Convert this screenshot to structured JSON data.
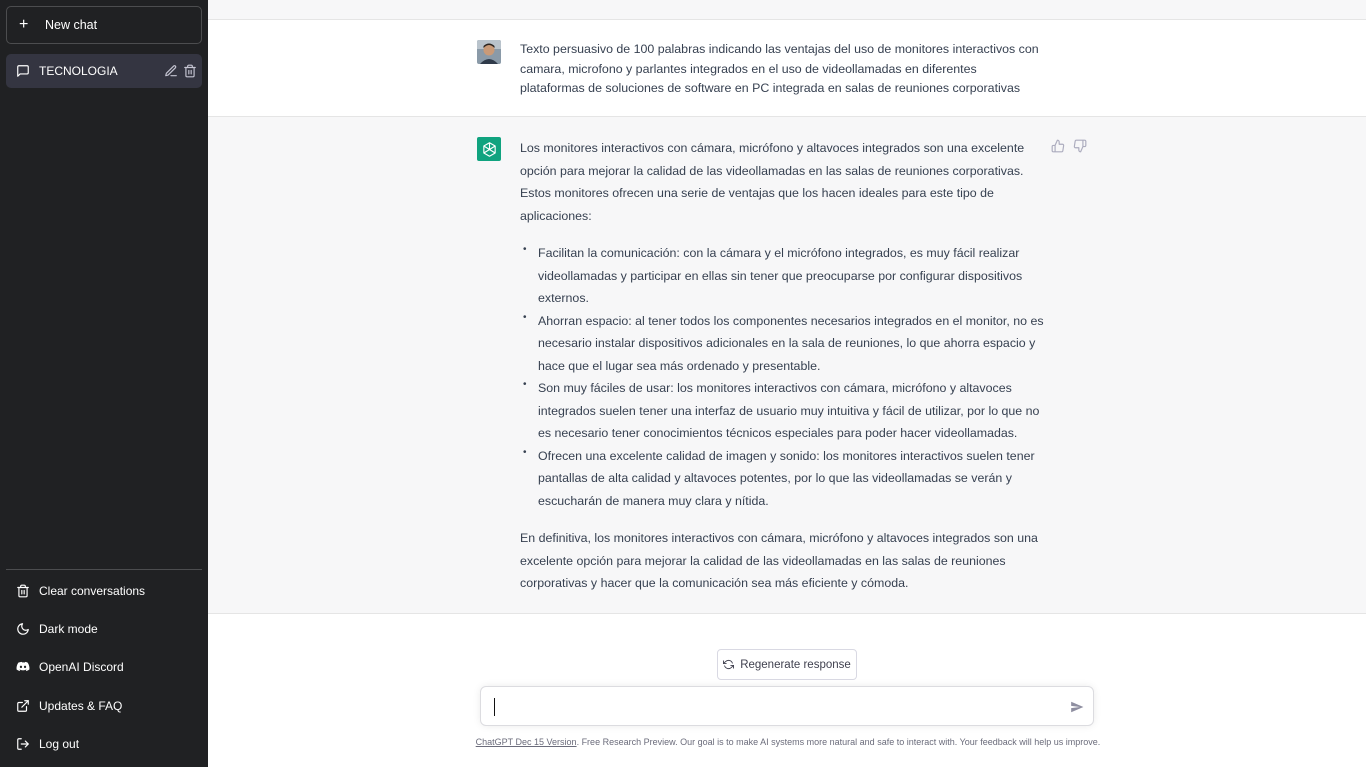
{
  "sidebar": {
    "new_chat_label": "New chat",
    "chats": [
      {
        "title": "TECNOLOGIA"
      }
    ],
    "links": {
      "clear": "Clear conversations",
      "dark_mode": "Dark mode",
      "discord": "OpenAI Discord",
      "updates": "Updates & FAQ",
      "logout": "Log out"
    }
  },
  "conversation": {
    "user_message": "Texto persuasivo de 100 palabras indicando las ventajas del uso de monitores interactivos con camara, microfono y parlantes integrados en el uso de videollamadas en diferentes plataformas de soluciones de software en PC integrada en salas de reuniones corporativas",
    "bot_intro": "Los monitores interactivos con cámara, micrófono y altavoces integrados son una excelente opción para mejorar la calidad de las videollamadas en las salas de reuniones corporativas. Estos monitores ofrecen una serie de ventajas que los hacen ideales para este tipo de aplicaciones:",
    "bot_bullets": [
      "Facilitan la comunicación: con la cámara y el micrófono integrados, es muy fácil realizar videollamadas y participar en ellas sin tener que preocuparse por configurar dispositivos externos.",
      "Ahorran espacio: al tener todos los componentes necesarios integrados en el monitor, no es necesario instalar dispositivos adicionales en la sala de reuniones, lo que ahorra espacio y hace que el lugar sea más ordenado y presentable.",
      "Son muy fáciles de usar: los monitores interactivos con cámara, micrófono y altavoces integrados suelen tener una interfaz de usuario muy intuitiva y fácil de utilizar, por lo que no es necesario tener conocimientos técnicos especiales para poder hacer videollamadas.",
      "Ofrecen una excelente calidad de imagen y sonido: los monitores interactivos suelen tener pantallas de alta calidad y altavoces potentes, por lo que las videollamadas se verán y escucharán de manera muy clara y nítida."
    ],
    "bot_conclusion": "En definitiva, los monitores interactivos con cámara, micrófono y altavoces integrados son una excelente opción para mejorar la calidad de las videollamadas en las salas de reuniones corporativas y hacer que la comunicación sea más eficiente y cómoda."
  },
  "composer": {
    "regenerate_label": "Regenerate response",
    "input_value": "",
    "input_placeholder": ""
  },
  "footer": {
    "version_link": "ChatGPT Dec 15 Version",
    "note": ". Free Research Preview. Our goal is to make AI systems more natural and safe to interact with. Your feedback will help us improve."
  },
  "colors": {
    "sidebar_bg": "#202123",
    "accent": "#10a37f",
    "bot_row_bg": "#f7f7f8"
  },
  "icons": [
    "plus-icon",
    "chat-bubble-icon",
    "edit-icon",
    "trash-icon",
    "moon-icon",
    "discord-icon",
    "external-link-icon",
    "logout-icon",
    "thumbs-up-icon",
    "thumbs-down-icon",
    "refresh-icon",
    "send-icon",
    "openai-logo-icon"
  ]
}
